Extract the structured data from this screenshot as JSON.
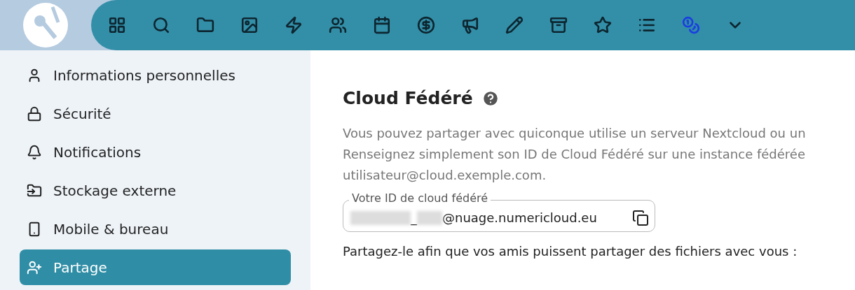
{
  "nav": {
    "apps": [
      {
        "kind": "grid"
      },
      {
        "kind": "search"
      },
      {
        "kind": "folder"
      },
      {
        "kind": "image"
      },
      {
        "kind": "bolt"
      },
      {
        "kind": "users"
      },
      {
        "kind": "calendar"
      },
      {
        "kind": "moneybag"
      },
      {
        "kind": "megaphone"
      },
      {
        "kind": "pencil"
      },
      {
        "kind": "archive"
      },
      {
        "kind": "star"
      },
      {
        "kind": "list"
      },
      {
        "kind": "coins"
      },
      {
        "kind": "more"
      }
    ]
  },
  "sidebar": {
    "items": [
      {
        "label": "Informations personnelles",
        "kind": "user",
        "selected": false
      },
      {
        "label": "Sécurité",
        "kind": "lock",
        "selected": false
      },
      {
        "label": "Notifications",
        "kind": "bell",
        "selected": false
      },
      {
        "label": "Stockage externe",
        "kind": "storage",
        "selected": false
      },
      {
        "label": "Mobile & bureau",
        "kind": "phone",
        "selected": false
      },
      {
        "label": "Partage",
        "kind": "share",
        "selected": true
      }
    ]
  },
  "section": {
    "title": "Cloud Fédéré",
    "description_lines": [
      "Vous pouvez partager avec quiconque utilise un serveur Nextcloud ou un",
      "Renseignez simplement son ID de Cloud Fédéré sur une instance fédérée",
      "utilisateur@cloud.exemple.com."
    ],
    "id_field": {
      "label": "Votre ID de cloud fédéré",
      "separator": "_",
      "value": "@nuage.numericloud.eu"
    },
    "share_text": "Partagez-le afin que vos amis puissent partager des fichiers avec vous :"
  }
}
